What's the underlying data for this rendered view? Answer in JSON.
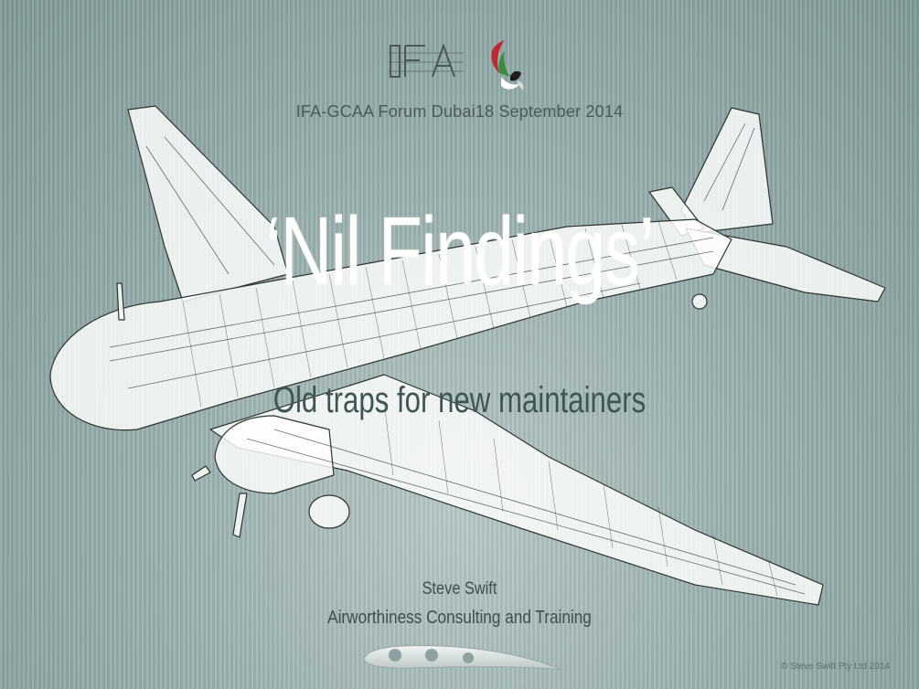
{
  "header": {
    "ifa_logo_text": "IFA",
    "event_line": "IFA-GCAA Forum Dubai18 September 2014"
  },
  "title": {
    "main": "‘Nil Findings’",
    "subtitle": "Old traps for new maintainers"
  },
  "presenter": {
    "name": "Steve Swift",
    "organization": "Airworthiness Consulting and Training"
  },
  "footer": {
    "copyright": "© Steve Swift Pty Ltd 2014"
  },
  "icons": [
    "ifa-logo-icon",
    "gcaa-falcon-logo-icon",
    "airfoil-logo-icon",
    "aircraft-cutaway-illustration"
  ],
  "colors": {
    "background": "#8fa7a5",
    "title": "#ffffff",
    "subtitle": "#3f5554",
    "body_text": "#3f4f4e"
  }
}
